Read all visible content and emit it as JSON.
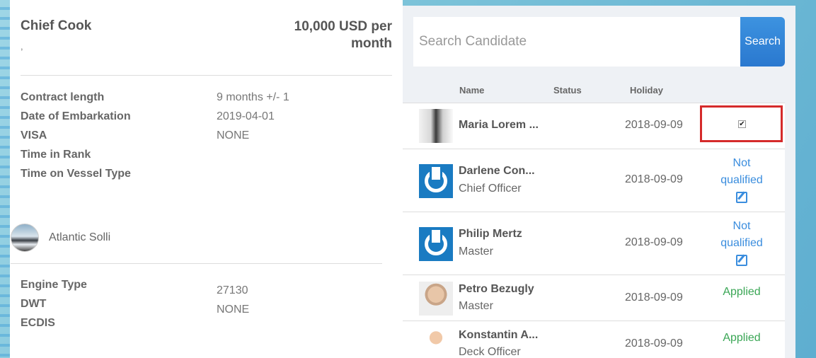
{
  "job": {
    "title": "Chief Cook",
    "subtitle": ",",
    "salary": "10,000 USD per month"
  },
  "details": [
    {
      "label": "Contract length",
      "value": "9 months +/- 1"
    },
    {
      "label": "Date of Embarkation",
      "value": "2019-04-01"
    },
    {
      "label": "VISA",
      "value": "NONE"
    },
    {
      "label": "Time in Rank",
      "value": ""
    },
    {
      "label": "Time on Vessel Type",
      "value": ""
    }
  ],
  "vessel": {
    "name": "Atlantic Solli"
  },
  "specs": [
    {
      "label": "Engine Type",
      "value": "27130"
    },
    {
      "label": "DWT",
      "value": "NONE"
    },
    {
      "label": "ECDIS",
      "value": ""
    }
  ],
  "search": {
    "placeholder": "Search Candidate",
    "button_label": "Search"
  },
  "table": {
    "headers": {
      "name": "Name",
      "status": "Status",
      "holiday": "Holiday"
    },
    "rows": [
      {
        "name": "Maria Lorem ...",
        "rank": "",
        "holiday": "2018-09-09",
        "status": "",
        "status_type": "checkbox",
        "checkbox_glyph": "✔"
      },
      {
        "name": "Darlene Con...",
        "rank": "Chief Officer",
        "holiday": "2018-09-09",
        "status_line1": "Not",
        "status_line2": "qualified",
        "status_type": "not-qualified"
      },
      {
        "name": "Philip Mertz",
        "rank": "Master",
        "holiday": "2018-09-09",
        "status_line1": "Not",
        "status_line2": "qualified",
        "status_type": "not-qualified"
      },
      {
        "name": "Petro Bezugly",
        "rank": "Master",
        "holiday": "2018-09-09",
        "status": "Applied",
        "status_type": "applied"
      },
      {
        "name": "Konstantin A...",
        "rank": "Deck Officer",
        "holiday": "2018-09-09",
        "status": "Applied",
        "status_type": "applied"
      }
    ]
  },
  "colors": {
    "accent": "#3a8dde",
    "applied": "#3aa655",
    "highlight": "#d52a2a"
  }
}
